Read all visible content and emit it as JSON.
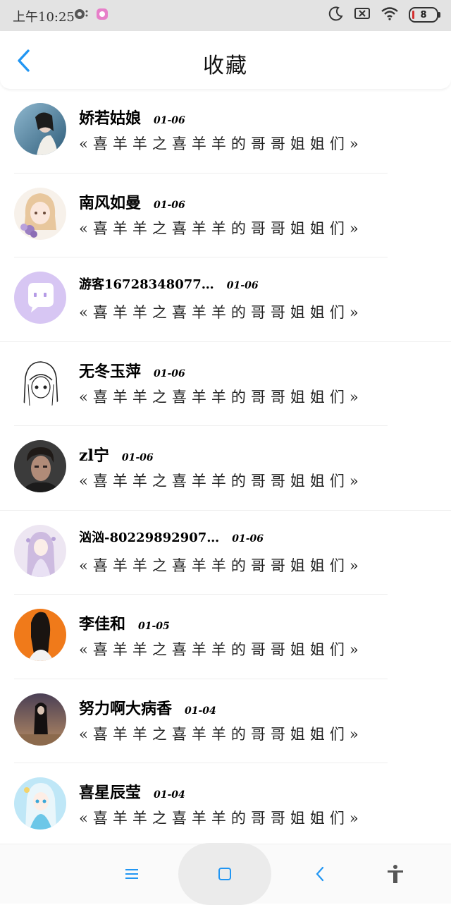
{
  "status_bar": {
    "time": "上午10:25",
    "battery_level": "8",
    "icons": [
      "notification-icon",
      "app-icon",
      "moon-icon",
      "no-sim-icon",
      "wifi-icon",
      "battery-icon"
    ]
  },
  "header": {
    "title": "收藏",
    "back_icon": "chevron-left-icon",
    "accent_color": "#2196f3"
  },
  "items": [
    {
      "name": "娇若姑娘",
      "date": "01-06",
      "title": "«喜羊羊之喜羊羊的哥哥姐姐们»",
      "avatar": "avatar-girl-blue"
    },
    {
      "name": "南风如曼",
      "date": "01-06",
      "title": "«喜羊羊之喜羊羊的哥哥姐姐们»",
      "avatar": "avatar-anime-girl-flowers"
    },
    {
      "name": "游客16728348077…",
      "date": "01-06",
      "title": "«喜羊羊之喜羊羊的哥哥姐姐们»",
      "avatar": "avatar-chat-bubble"
    },
    {
      "name": "无冬玉萍",
      "date": "01-06",
      "title": "«喜羊羊之喜羊羊的哥哥姐姐们»",
      "avatar": "avatar-sketch-girl"
    },
    {
      "name": "zl宁",
      "date": "01-06",
      "title": "«喜羊羊之喜羊羊的哥哥姐姐们»",
      "avatar": "avatar-man-dark"
    },
    {
      "name": "汹汹-80229892907…",
      "date": "01-06",
      "title": "«喜羊羊之喜羊羊的哥哥姐姐们»",
      "avatar": "avatar-anime-lavender"
    },
    {
      "name": "李佳和",
      "date": "01-05",
      "title": "«喜羊羊之喜羊羊的哥哥姐姐们»",
      "avatar": "avatar-orange-black"
    },
    {
      "name": "努力啊大病香",
      "date": "01-04",
      "title": "«喜羊羊之喜羊羊的哥哥姐姐们»",
      "avatar": "avatar-dark-figure"
    },
    {
      "name": "喜星辰莹",
      "date": "01-04",
      "title": "«喜羊羊之喜羊羊的哥哥姐姐们»",
      "avatar": "avatar-anime-cyan"
    }
  ],
  "nav_bar": {
    "icons": [
      "menu-icon",
      "home-square-icon",
      "back-arrow-icon",
      "accessibility-icon"
    ]
  }
}
